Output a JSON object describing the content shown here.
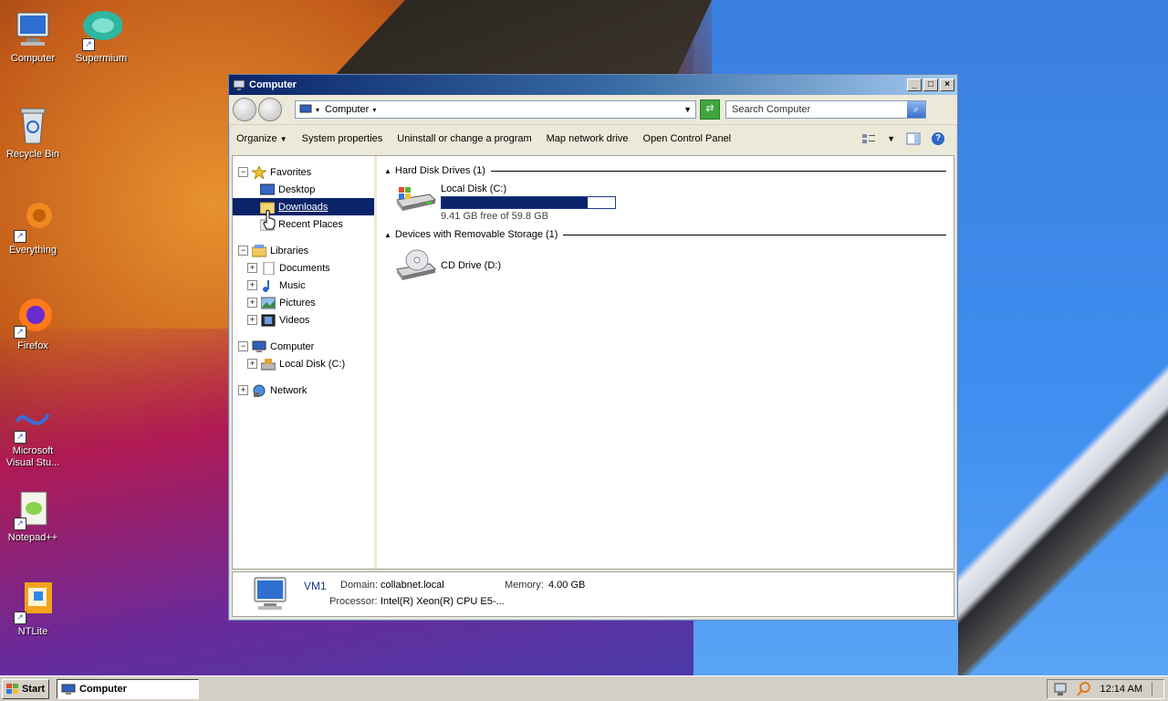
{
  "desktop": {
    "icons": [
      {
        "label": "Computer"
      },
      {
        "label": "Supermium"
      },
      {
        "label": "Recycle Bin"
      },
      {
        "label": "Everything"
      },
      {
        "label": "Firefox"
      },
      {
        "label": "Microsoft Visual Stu..."
      },
      {
        "label": "Notepad++"
      },
      {
        "label": "NTLite"
      }
    ]
  },
  "window": {
    "title": "Computer",
    "controls": {
      "minimize": "_",
      "maximize": "□",
      "close": "×"
    },
    "address": {
      "crumb": "Computer"
    },
    "search": {
      "placeholder": "Search Computer"
    },
    "commands": [
      "Organize",
      "System properties",
      "Uninstall or change a program",
      "Map network drive",
      "Open Control Panel"
    ],
    "tree": {
      "favorites": "Favorites",
      "desktop": "Desktop",
      "downloads": "Downloads",
      "recent": "Recent Places",
      "libraries": "Libraries",
      "documents": "Documents",
      "music": "Music",
      "pictures": "Pictures",
      "videos": "Videos",
      "computer": "Computer",
      "localdisk": "Local Disk (C:)",
      "network": "Network"
    },
    "groups": {
      "hdd": "Hard Disk Drives (1)",
      "removable": "Devices with Removable Storage (1)"
    },
    "drives": {
      "c_name": "Local Disk (C:)",
      "c_free": "9.41 GB free of 59.8 GB",
      "c_used_fraction": 0.84,
      "d_name": "CD Drive (D:)"
    },
    "details": {
      "name": "VM1",
      "domain_label": "Domain:",
      "domain": "collabnet.local",
      "memory_label": "Memory:",
      "memory": "4.00 GB",
      "processor_label": "Processor:",
      "processor": "Intel(R) Xeon(R) CPU E5-..."
    }
  },
  "taskbar": {
    "start": "Start",
    "task": "Computer",
    "clock": "12:14 AM"
  }
}
